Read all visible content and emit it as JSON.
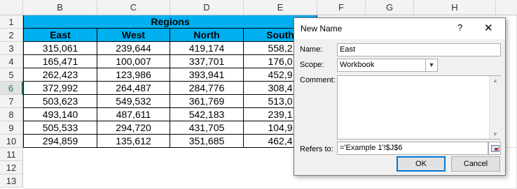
{
  "columns": [
    "B",
    "C",
    "D",
    "E",
    "F",
    "G",
    "H"
  ],
  "rows": [
    "1",
    "2",
    "3",
    "4",
    "5",
    "6",
    "7",
    "8",
    "9",
    "10",
    "11",
    "12",
    "13"
  ],
  "selected_row": "6",
  "table": {
    "title": "Regions",
    "headers": [
      "East",
      "West",
      "North",
      "South"
    ],
    "data": [
      [
        "315,061",
        "239,644",
        "419,174",
        "558,2"
      ],
      [
        "165,471",
        "100,007",
        "337,701",
        "176,0"
      ],
      [
        "262,423",
        "123,986",
        "393,941",
        "452,9"
      ],
      [
        "372,992",
        "264,487",
        "284,776",
        "308,4"
      ],
      [
        "503,623",
        "549,532",
        "361,769",
        "513,0"
      ],
      [
        "493,140",
        "487,611",
        "542,183",
        "239,1"
      ],
      [
        "505,533",
        "294,720",
        "431,705",
        "104,9"
      ],
      [
        "294,859",
        "135,612",
        "351,685",
        "462,4"
      ]
    ]
  },
  "dialog": {
    "title": "New Name",
    "help": "?",
    "close": "✕",
    "name_label": "Name:",
    "name_value": "East",
    "scope_label": "Scope:",
    "scope_value": "Workbook",
    "comment_label": "Comment:",
    "comment_value": "",
    "refers_label": "Refers to:",
    "refers_value": "='Example 1'!$J$6",
    "ok": "OK",
    "cancel": "Cancel"
  },
  "colors": {
    "header_fill": "#00b0f0",
    "accent": "#217346"
  }
}
